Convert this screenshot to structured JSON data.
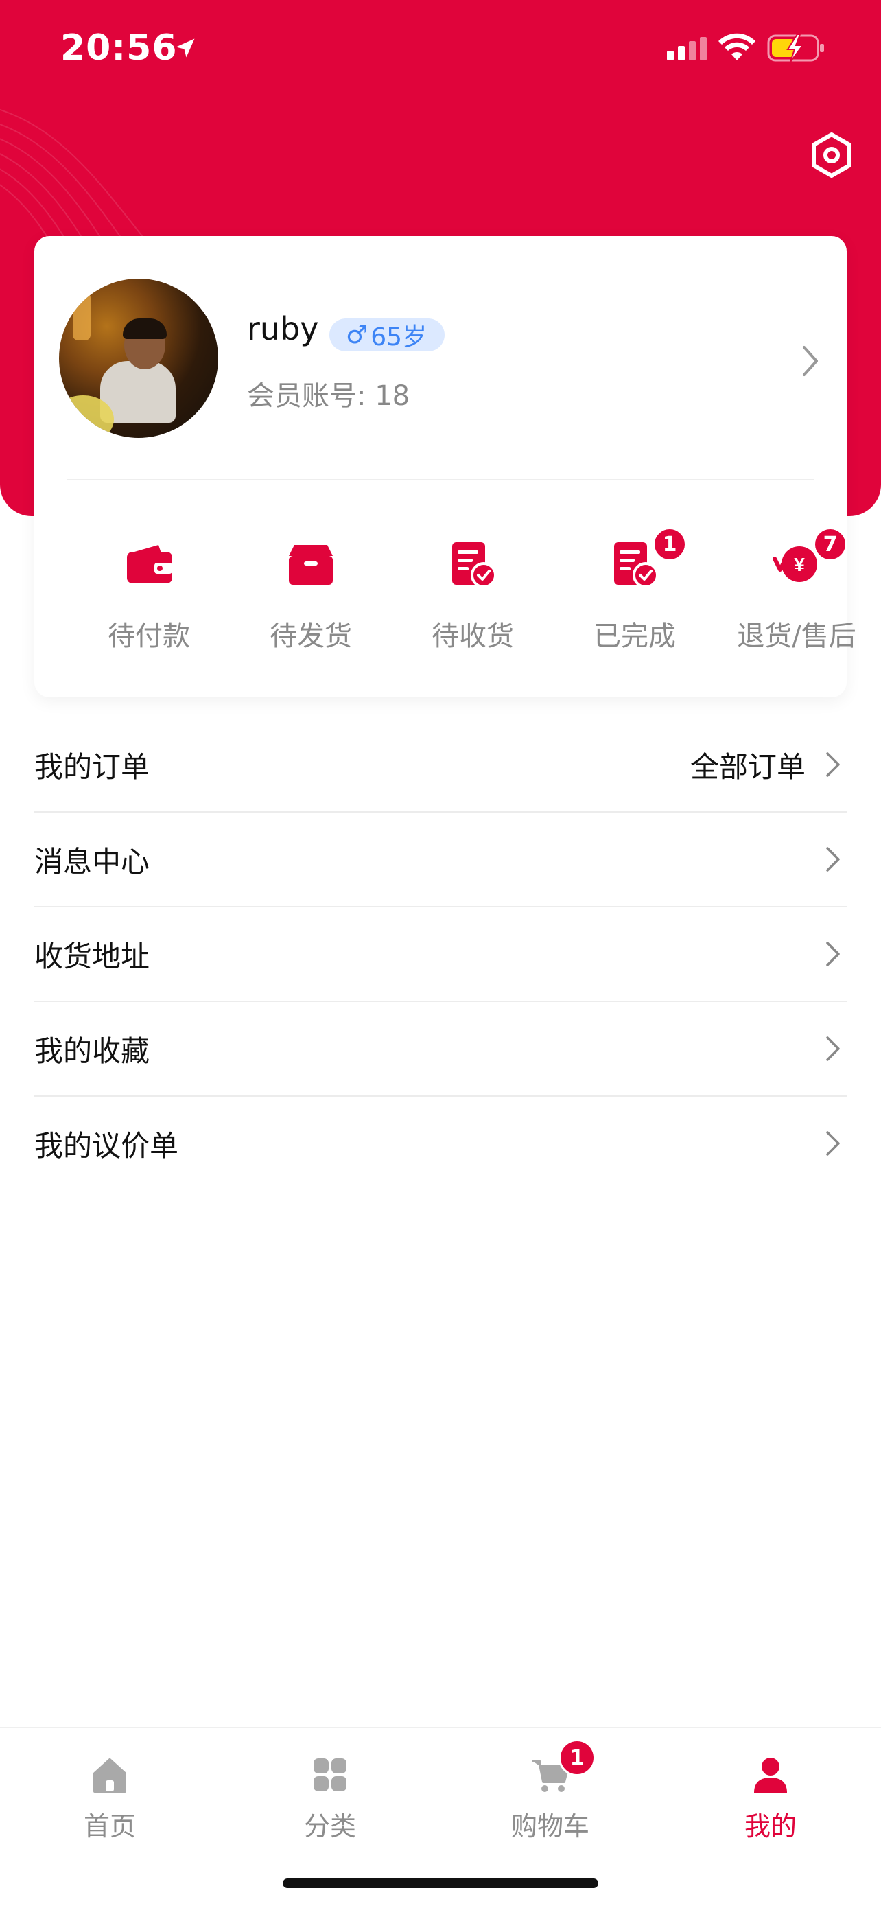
{
  "status_bar": {
    "time": "20:56"
  },
  "profile": {
    "name": "ruby",
    "gender_symbol": "♂",
    "age": "65岁",
    "member_label": "会员账号:",
    "member_id": "18"
  },
  "orders": [
    {
      "label": "待付款",
      "icon": "wallet-icon",
      "badge": ""
    },
    {
      "label": "待发货",
      "icon": "box-icon",
      "badge": ""
    },
    {
      "label": "待收货",
      "icon": "document-check-icon",
      "badge": ""
    },
    {
      "label": "已完成",
      "icon": "document-done-icon",
      "badge": "1"
    },
    {
      "label": "退货/售后",
      "icon": "refund-icon",
      "badge": "7"
    }
  ],
  "menu": {
    "my_orders": "我的订单",
    "all_orders": "全部订单",
    "messages": "消息中心",
    "address": "收货地址",
    "favorites": "我的收藏",
    "quotes": "我的议价单"
  },
  "tabbar": {
    "home": "首页",
    "category": "分类",
    "cart": "购物车",
    "cart_badge": "1",
    "mine": "我的"
  },
  "colors": {
    "brand": "#e0043b",
    "badge_bg": "#dce9ff",
    "badge_text": "#3d84f5"
  }
}
